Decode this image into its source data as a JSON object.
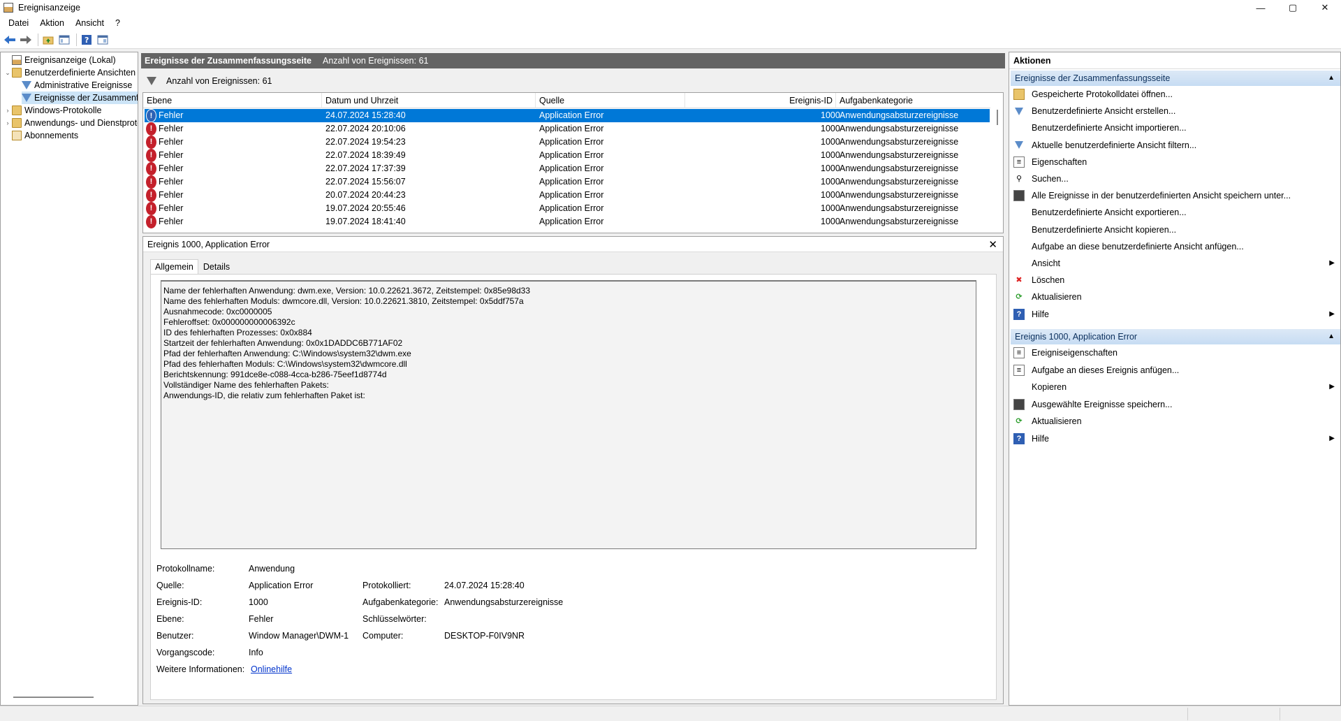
{
  "window": {
    "title": "Ereignisanzeige",
    "controls": [
      "—",
      "▢",
      "✕"
    ]
  },
  "menu": [
    "Datei",
    "Aktion",
    "Ansicht",
    "?"
  ],
  "tree": {
    "items": [
      {
        "label": "Ereignisanzeige (Lokal)",
        "level": 0
      },
      {
        "label": "Benutzerdefinierte Ansichten",
        "level": 1,
        "expanded": true
      },
      {
        "label": "Administrative Ereignisse",
        "level": 2
      },
      {
        "label": "Ereignisse der Zusammenfassungsseite",
        "level": 2,
        "selected": true
      },
      {
        "label": "Windows-Protokolle",
        "level": 1
      },
      {
        "label": "Anwendungs- und Dienstprotokolle",
        "level": 1
      },
      {
        "label": "Abonnements",
        "level": 1
      }
    ]
  },
  "center": {
    "header_title": "Ereignisse der Zusammenfassungsseite",
    "header_count": "Anzahl von Ereignissen: 61",
    "filter_text": "Anzahl von Ereignissen: 61",
    "columns": [
      "Ebene",
      "Datum und Uhrzeit",
      "Quelle",
      "Ereignis-ID",
      "Aufgabenkategorie"
    ],
    "rows": [
      {
        "level": "Fehler",
        "date": "24.07.2024 15:28:40",
        "source": "Application Error",
        "id": "1000",
        "category": "Anwendungsabsturzereignisse",
        "selected": true
      },
      {
        "level": "Fehler",
        "date": "22.07.2024 20:10:06",
        "source": "Application Error",
        "id": "1000",
        "category": "Anwendungsabsturzereignisse"
      },
      {
        "level": "Fehler",
        "date": "22.07.2024 19:54:23",
        "source": "Application Error",
        "id": "1000",
        "category": "Anwendungsabsturzereignisse"
      },
      {
        "level": "Fehler",
        "date": "22.07.2024 18:39:49",
        "source": "Application Error",
        "id": "1000",
        "category": "Anwendungsabsturzereignisse"
      },
      {
        "level": "Fehler",
        "date": "22.07.2024 17:37:39",
        "source": "Application Error",
        "id": "1000",
        "category": "Anwendungsabsturzereignisse"
      },
      {
        "level": "Fehler",
        "date": "22.07.2024 15:56:07",
        "source": "Application Error",
        "id": "1000",
        "category": "Anwendungsabsturzereignisse"
      },
      {
        "level": "Fehler",
        "date": "20.07.2024 20:44:23",
        "source": "Application Error",
        "id": "1000",
        "category": "Anwendungsabsturzereignisse"
      },
      {
        "level": "Fehler",
        "date": "19.07.2024 20:55:46",
        "source": "Application Error",
        "id": "1000",
        "category": "Anwendungsabsturzereignisse"
      },
      {
        "level": "Fehler",
        "date": "19.07.2024 18:41:40",
        "source": "Application Error",
        "id": "1000",
        "category": "Anwendungsabsturzereignisse"
      }
    ]
  },
  "detail": {
    "title": "Ereignis 1000, Application Error",
    "close": "✕",
    "tabs": [
      "Allgemein",
      "Details"
    ],
    "description_lines": [
      "Name der fehlerhaften Anwendung: dwm.exe, Version: 10.0.22621.3672, Zeitstempel: 0x85e98d33",
      "Name des fehlerhaften Moduls: dwmcore.dll, Version: 10.0.22621.3810, Zeitstempel: 0x5ddf757a",
      "Ausnahmecode: 0xc0000005",
      "Fehleroffset: 0x000000000006392c",
      "ID des fehlerhaften Prozesses: 0x0x884",
      "Startzeit der fehlerhaften Anwendung: 0x0x1DADDC6B771AF02",
      "Pfad der fehlerhaften Anwendung: C:\\Windows\\system32\\dwm.exe",
      "Pfad des fehlerhaften Moduls: C:\\Windows\\system32\\dwmcore.dll",
      "Berichtskennung: 991dce8e-c088-4cca-b286-75eef1d8774d",
      "Vollständiger Name des fehlerhaften Pakets:",
      "Anwendungs-ID, die relativ zum fehlerhaften Paket ist:"
    ],
    "props": {
      "protokollname_label": "Protokollname:",
      "protokollname": "Anwendung",
      "quelle_label": "Quelle:",
      "quelle": "Application Error",
      "protokolliert_label": "Protokolliert:",
      "protokolliert": "24.07.2024 15:28:40",
      "ereignisid_label": "Ereignis-ID:",
      "ereignisid": "1000",
      "aufgabe_label": "Aufgabenkategorie:",
      "aufgabe": "Anwendungsabsturzereignisse",
      "ebene_label": "Ebene:",
      "ebene": "Fehler",
      "schluessel_label": "Schlüsselwörter:",
      "benutzer_label": "Benutzer:",
      "benutzer": "Window Manager\\DWM-1",
      "computer_label": "Computer:",
      "computer": "DESKTOP-F0IV9NR",
      "vorgang_label": "Vorgangscode:",
      "vorgang": "Info",
      "weitere_label": "Weitere Informationen:",
      "weitere_link": "Onlinehilfe"
    }
  },
  "actions": {
    "title": "Aktionen",
    "section1": "Ereignisse der Zusammenfassungsseite",
    "section1_items": [
      {
        "label": "Gespeicherte Protokolldatei öffnen...",
        "icon": "folder-open-icon"
      },
      {
        "label": "Benutzerdefinierte Ansicht erstellen...",
        "icon": "filter-icon"
      },
      {
        "label": "Benutzerdefinierte Ansicht importieren...",
        "icon": ""
      },
      {
        "label": "Aktuelle benutzerdefinierte Ansicht filtern...",
        "icon": "filter-icon"
      },
      {
        "label": "Eigenschaften",
        "icon": "properties-icon"
      },
      {
        "label": "Suchen...",
        "icon": "binoculars-icon"
      },
      {
        "label": "Alle Ereignisse in der benutzerdefinierten Ansicht speichern unter...",
        "icon": "save-icon"
      },
      {
        "label": "Benutzerdefinierte Ansicht exportieren...",
        "icon": ""
      },
      {
        "label": "Benutzerdefinierte Ansicht kopieren...",
        "icon": ""
      },
      {
        "label": "Aufgabe an diese benutzerdefinierte Ansicht anfügen...",
        "icon": ""
      },
      {
        "label": "Ansicht",
        "icon": "",
        "submenu": true
      },
      {
        "label": "Löschen",
        "icon": "delete-icon"
      },
      {
        "label": "Aktualisieren",
        "icon": "refresh-icon"
      },
      {
        "label": "Hilfe",
        "icon": "help-icon",
        "submenu": true
      }
    ],
    "section2": "Ereignis 1000, Application Error",
    "section2_items": [
      {
        "label": "Ereigniseigenschaften",
        "icon": "properties-icon"
      },
      {
        "label": "Aufgabe an dieses Ereignis anfügen...",
        "icon": "task-icon"
      },
      {
        "label": "Kopieren",
        "icon": "copy-icon",
        "submenu": true
      },
      {
        "label": "Ausgewählte Ereignisse speichern...",
        "icon": "save-icon"
      },
      {
        "label": "Aktualisieren",
        "icon": "refresh-icon"
      },
      {
        "label": "Hilfe",
        "icon": "help-icon",
        "submenu": true
      }
    ]
  }
}
